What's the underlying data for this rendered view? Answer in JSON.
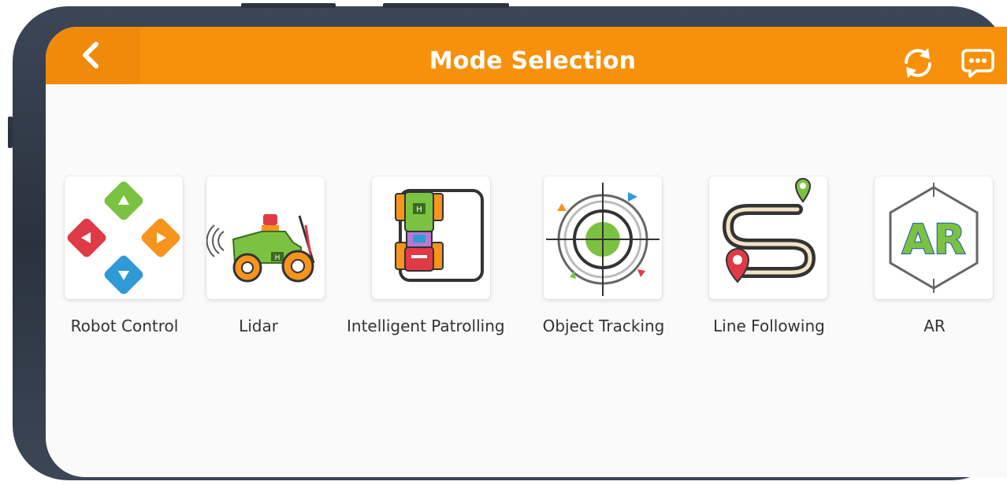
{
  "header": {
    "title": "Mode Selection",
    "background_color": "#f7910b",
    "back_icon": "chevron-left-icon",
    "actions": [
      "refresh-icon",
      "chat-icon"
    ]
  },
  "modes": [
    {
      "label": "Robot Control",
      "icon": "dpad-icon"
    },
    {
      "label": "Lidar",
      "icon": "lidar-robot-icon"
    },
    {
      "label": "Intelligent Patrolling",
      "icon": "patrol-robot-icon"
    },
    {
      "label": "Object Tracking",
      "icon": "target-icon"
    },
    {
      "label": "Line Following",
      "icon": "route-path-icon"
    },
    {
      "label": "AR",
      "icon": "ar-icon",
      "icon_text": "AR"
    }
  ]
}
